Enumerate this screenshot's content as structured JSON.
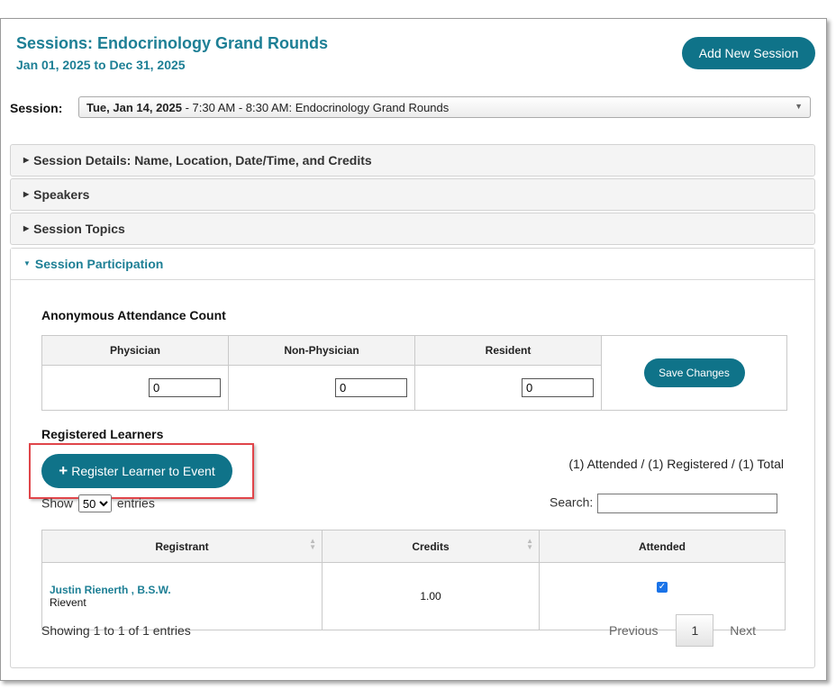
{
  "header": {
    "title": "Sessions: Endocrinology Grand Rounds",
    "date_range": "Jan 01, 2025 to Dec 31, 2025",
    "add_session_label": "Add New Session"
  },
  "session_select": {
    "label": "Session:",
    "selected_date": "Tue, Jan 14, 2025",
    "selected_rest": " - 7:30 AM - 8:30 AM: Endocrinology Grand Rounds"
  },
  "accordion": {
    "details": "Session Details: Name, Location, Date/Time, and Credits",
    "speakers": "Speakers",
    "topics": "Session Topics",
    "participation": "Session Participation"
  },
  "attendance": {
    "title": "Anonymous Attendance Count",
    "columns": [
      "Physician",
      "Non-Physician",
      "Resident"
    ],
    "values": [
      "0",
      "0",
      "0"
    ],
    "save_label": "Save Changes"
  },
  "learners": {
    "title": "Registered Learners",
    "register_label": "Register Learner to Event",
    "totals": "(1) Attended / (1) Registered / (1) Total",
    "show_label": "Show",
    "entries_value": "50",
    "entries_label": "entries",
    "search_label": "Search:",
    "columns": [
      "Registrant",
      "Credits",
      "Attended"
    ],
    "rows": [
      {
        "name": "Justin Rienerth , B.S.W.",
        "org": "Rievent",
        "credits": "1.00",
        "attended": true
      }
    ],
    "showing": "Showing 1 to 1 of 1 entries",
    "pager": {
      "previous": "Previous",
      "page": "1",
      "next": "Next"
    }
  }
}
